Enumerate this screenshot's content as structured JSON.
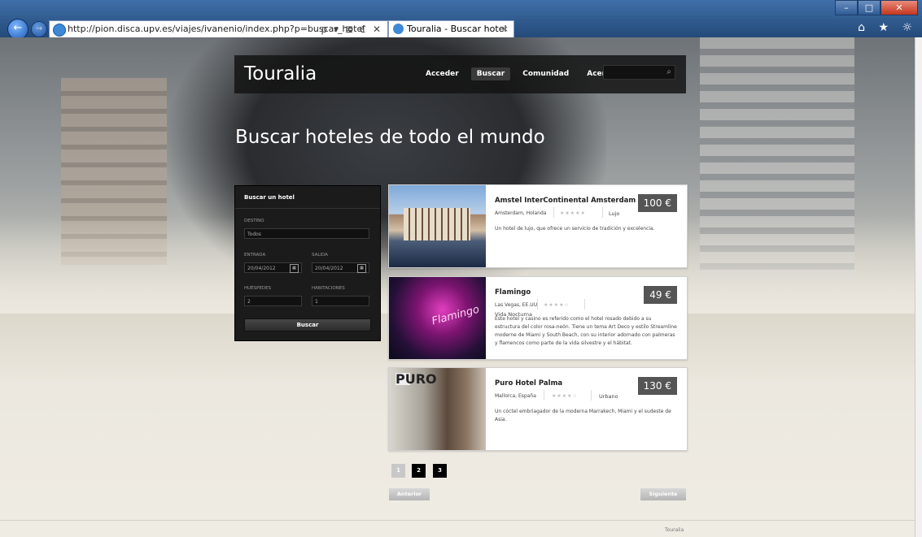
{
  "browser": {
    "url": "http://pion.disca.upv.es/viajes/ivanenio/index.php?p=buscar_hotel",
    "tab_title": "Touralia - Buscar hotel",
    "tab_close": "×",
    "addr_tools": "ρ ▾ ≣ ℭ ✕",
    "right_icons": "⌂ ★ ☼"
  },
  "site": {
    "logo": "Touralia",
    "menu": [
      "Acceder",
      "Buscar",
      "Comunidad",
      "Acerca"
    ],
    "active_menu": "Buscar",
    "page_title": "Buscar hoteles de todo el mundo"
  },
  "search_panel": {
    "title": "Buscar un hotel",
    "destino_label": "DESTINO",
    "destino_value": "Todos",
    "entrada_label": "ENTRADA",
    "entrada_value": "20/04/2012",
    "salida_label": "SALIDA",
    "salida_value": "20/04/2012",
    "huespedes_label": "HUÉSPEDES",
    "huespedes_value": "2",
    "habitaciones_label": "HABITACIONES",
    "habitaciones_value": "1",
    "submit_label": "Buscar"
  },
  "hotels": [
    {
      "name": "Amstel InterContinental Amsterdam",
      "location": "Amsterdam, Holanda",
      "stars": "★★★★★",
      "category": "Lujo",
      "price": "100 €",
      "description": "Un hotel de lujo, que ofrece un servicio de tradición y excelencia."
    },
    {
      "name": "Flamingo",
      "location": "Las Vegas, EE.UU",
      "stars": "★★★★☆",
      "category": "Vida Nocturna",
      "price": "49 €",
      "description": "Este hotel y casino es referido como el hotel rosado debido a su estructura del color rosa-neón. Tiene un tema Art Deco y estilo Streamline moderne de Miami y South Beach, con su interior adornado con palmeras y flamencos como parte de la vida silvestre y el hábitat.",
      "photo_text": "Flamingo"
    },
    {
      "name": "Puro Hotel Palma",
      "location": "Mallorca, España",
      "stars": "★★★★☆",
      "category": "Urbano",
      "price": "130 €",
      "description": "Un cóctel embriagador de la moderna Marrakech, Miami y el sudeste de Asia.",
      "photo_text": "PURO"
    }
  ],
  "pagination": {
    "pages": [
      "1",
      "2",
      "3"
    ],
    "current": "1",
    "prev_label": "Anterior",
    "next_label": "Siguiente"
  },
  "footer": {
    "text": "Touralia"
  }
}
